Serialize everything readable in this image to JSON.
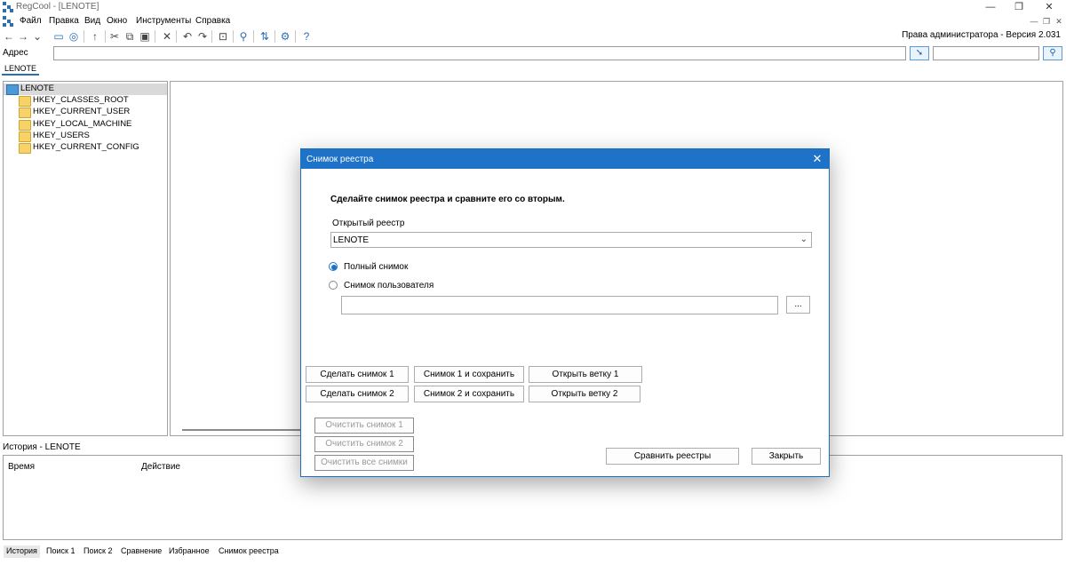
{
  "window": {
    "title": "RegCool - [LENOTE]"
  },
  "menu": [
    "Файл",
    "Правка",
    "Вид",
    "Окно",
    "Инструменты",
    "Справка"
  ],
  "toolbar": {
    "icons": [
      "back-icon",
      "forward-icon",
      "dropdown-icon",
      "computer-icon",
      "network-icon",
      "up-icon",
      "cut-icon",
      "copy-icon",
      "paste-icon",
      "delete-icon",
      "undo-icon",
      "redo-icon",
      "new-key-icon",
      "find-icon",
      "refresh-icon",
      "settings-icon",
      "help-icon"
    ],
    "rights": "Права администратора - Версия 2.031"
  },
  "address": {
    "label": "Адрес",
    "value": "",
    "search_value": ""
  },
  "doc_tab": "LENOTE",
  "tree": {
    "root": "LENOTE",
    "children": [
      "HKEY_CLASSES_ROOT",
      "HKEY_CURRENT_USER",
      "HKEY_LOCAL_MACHINE",
      "HKEY_USERS",
      "HKEY_CURRENT_CONFIG"
    ]
  },
  "history": {
    "header": "История - LENOTE",
    "columns": [
      "Время",
      "Действие"
    ]
  },
  "bottom_tabs": [
    "История",
    "Поиск 1",
    "Поиск 2",
    "Сравнение",
    "Избранное",
    "Снимок реестра"
  ],
  "dialog": {
    "title": "Снимок реестра",
    "heading": "Сделайте снимок реестра и сравните его со вторым.",
    "open_registry_label": "Открытый реестр",
    "open_registry_value": "LENOTE",
    "radio_full": "Полный снимок",
    "radio_user": "Снимок пользователя",
    "selected_radio": "full",
    "path_value": "",
    "browse": "...",
    "buttons": {
      "snap1": "Сделать снимок 1",
      "snap1_save": "Снимок 1 и сохранить",
      "open1": "Открыть ветку 1",
      "snap2": "Сделать снимок 2",
      "snap2_save": "Снимок 2 и сохранить",
      "open2": "Открыть ветку 2",
      "clear1": "Очистить снимок 1",
      "clear2": "Очистить снимок 2",
      "clear_all": "Очистить все снимки",
      "compare": "Сравнить реестры",
      "close": "Закрыть"
    },
    "accent": "#1e73c8"
  }
}
